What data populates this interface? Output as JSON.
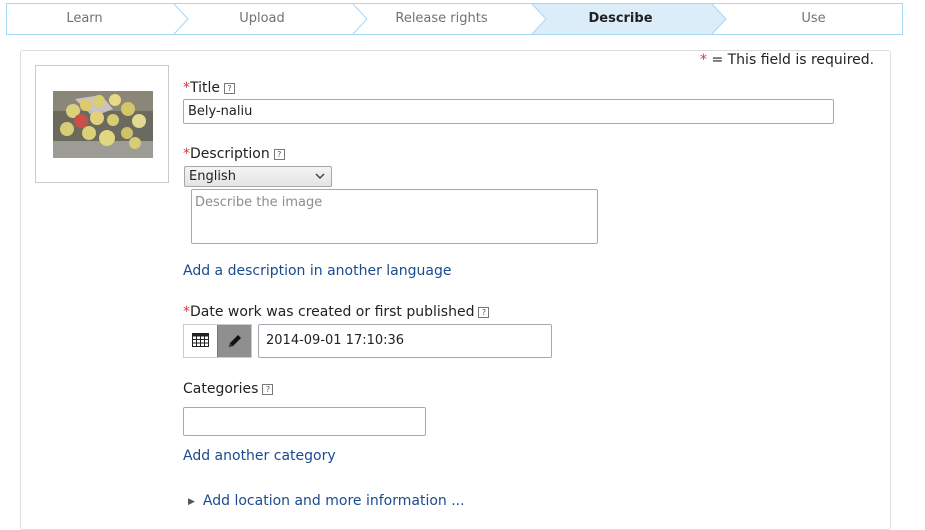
{
  "steps": [
    {
      "label": "Learn",
      "active": false
    },
    {
      "label": "Upload",
      "active": false
    },
    {
      "label": "Release rights",
      "active": false
    },
    {
      "label": "Describe",
      "active": true
    },
    {
      "label": "Use",
      "active": false
    }
  ],
  "colors": {
    "active_step_bg": "#dcedfa",
    "step_border": "#a7d7f9",
    "link": "#1a4b8f",
    "required": "#dd3333"
  },
  "form": {
    "required_note": {
      "star": "*",
      "text": "= This field is required."
    },
    "thumbnail": {
      "icon": "image-thumbnail"
    },
    "title": {
      "star": "*",
      "label": "Title",
      "help": "?",
      "value": "Bely-naliu"
    },
    "description": {
      "star": "*",
      "label": "Description",
      "help": "?",
      "language": "English",
      "placeholder": "Describe the image",
      "add_link": "Add a description in another language"
    },
    "date": {
      "star": "*",
      "label": "Date work was created or first published",
      "help": "?",
      "value": "2014-09-01 17:10:36",
      "calendar_icon": "calendar-icon",
      "edit_icon": "pencil-icon"
    },
    "categories": {
      "label": "Categories",
      "help": "?",
      "value": "",
      "add_link": "Add another category"
    },
    "more_info": {
      "label": "Add location and more information ..."
    }
  }
}
